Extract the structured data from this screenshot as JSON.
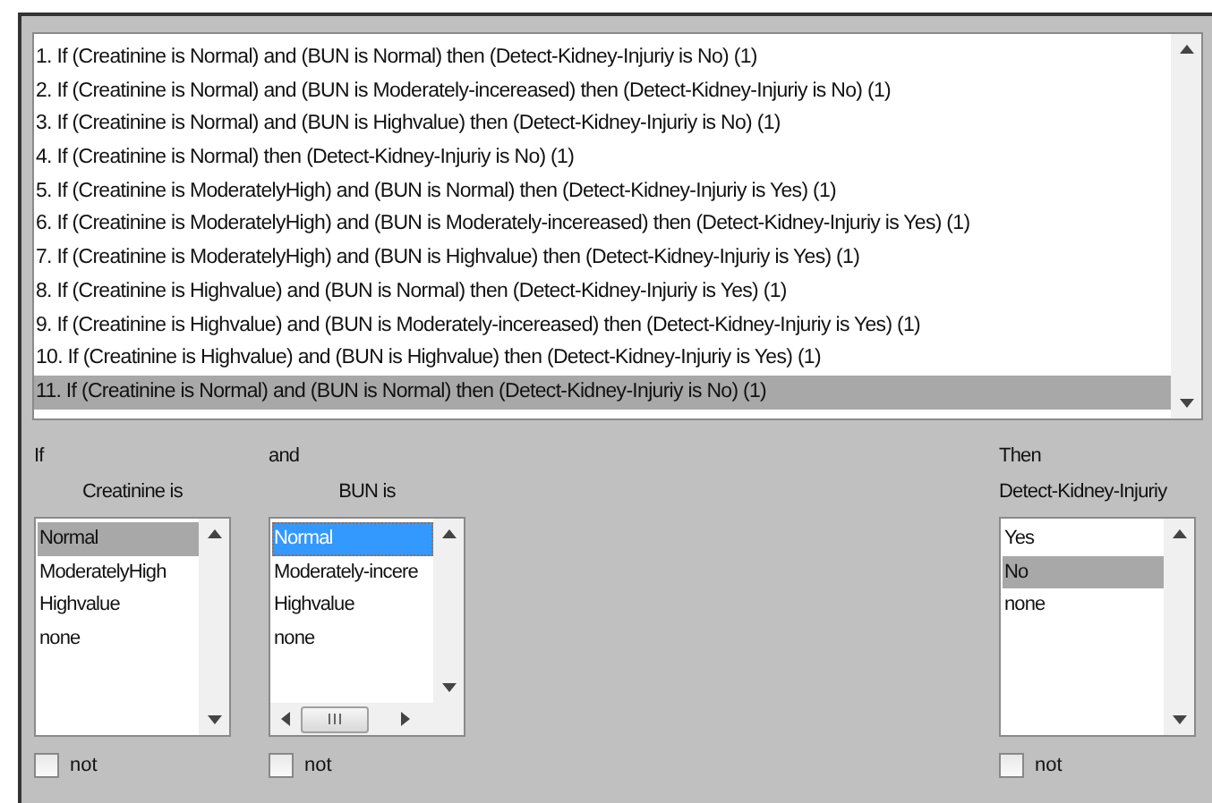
{
  "rules": [
    {
      "text": "1. If (Creatinine is Normal) and (BUN is Normal) then (Detect-Kidney-Injuriy is No) (1)",
      "selected": false
    },
    {
      "text": "2. If (Creatinine is Normal) and (BUN is Moderately-incereased) then (Detect-Kidney-Injuriy is No) (1)",
      "selected": false
    },
    {
      "text": "3. If (Creatinine is Normal) and (BUN is Highvalue) then (Detect-Kidney-Injuriy is No) (1)",
      "selected": false
    },
    {
      "text": "4. If (Creatinine is Normal) then (Detect-Kidney-Injuriy is No) (1)",
      "selected": false
    },
    {
      "text": "5. If (Creatinine is ModeratelyHigh) and (BUN is Normal) then (Detect-Kidney-Injuriy is Yes) (1)",
      "selected": false
    },
    {
      "text": "6. If (Creatinine is ModeratelyHigh) and (BUN is Moderately-incereased) then (Detect-Kidney-Injuriy is Yes) (1)",
      "selected": false
    },
    {
      "text": "7. If (Creatinine is ModeratelyHigh) and (BUN is Highvalue) then (Detect-Kidney-Injuriy is Yes) (1)",
      "selected": false
    },
    {
      "text": "8. If (Creatinine is Highvalue) and (BUN is Normal) then (Detect-Kidney-Injuriy is Yes) (1)",
      "selected": false
    },
    {
      "text": "9. If (Creatinine is Highvalue) and (BUN is Moderately-incereased) then (Detect-Kidney-Injuriy is Yes) (1)",
      "selected": false
    },
    {
      "text": "10. If (Creatinine is Highvalue) and (BUN is Highvalue) then (Detect-Kidney-Injuriy is Yes) (1)",
      "selected": false
    },
    {
      "text": "11. If (Creatinine is Normal) and (BUN is Normal) then (Detect-Kidney-Injuriy is No) (1)",
      "selected": true
    }
  ],
  "inputs": [
    {
      "connector": "If",
      "label": "Creatinine is",
      "focused": false,
      "horizontal_scroll": false,
      "items": [
        {
          "label": "Normal",
          "selected": true
        },
        {
          "label": "ModeratelyHigh",
          "selected": false
        },
        {
          "label": "Highvalue",
          "selected": false
        },
        {
          "label": "none",
          "selected": false
        }
      ],
      "not_label": "not",
      "not_checked": false
    },
    {
      "connector": "and",
      "label": "BUN is",
      "focused": true,
      "horizontal_scroll": true,
      "items": [
        {
          "label": "Normal",
          "selected": true
        },
        {
          "label": "Moderately-incere",
          "selected": false
        },
        {
          "label": "Highvalue",
          "selected": false
        },
        {
          "label": "none",
          "selected": false
        }
      ],
      "not_label": "not",
      "not_checked": false
    }
  ],
  "output": {
    "connector": "Then",
    "label": "Detect-Kidney-Injuriy",
    "focused": false,
    "horizontal_scroll": false,
    "items": [
      {
        "label": "Yes",
        "selected": false
      },
      {
        "label": "No",
        "selected": true
      },
      {
        "label": "none",
        "selected": false
      }
    ],
    "not_label": "not",
    "not_checked": false
  }
}
